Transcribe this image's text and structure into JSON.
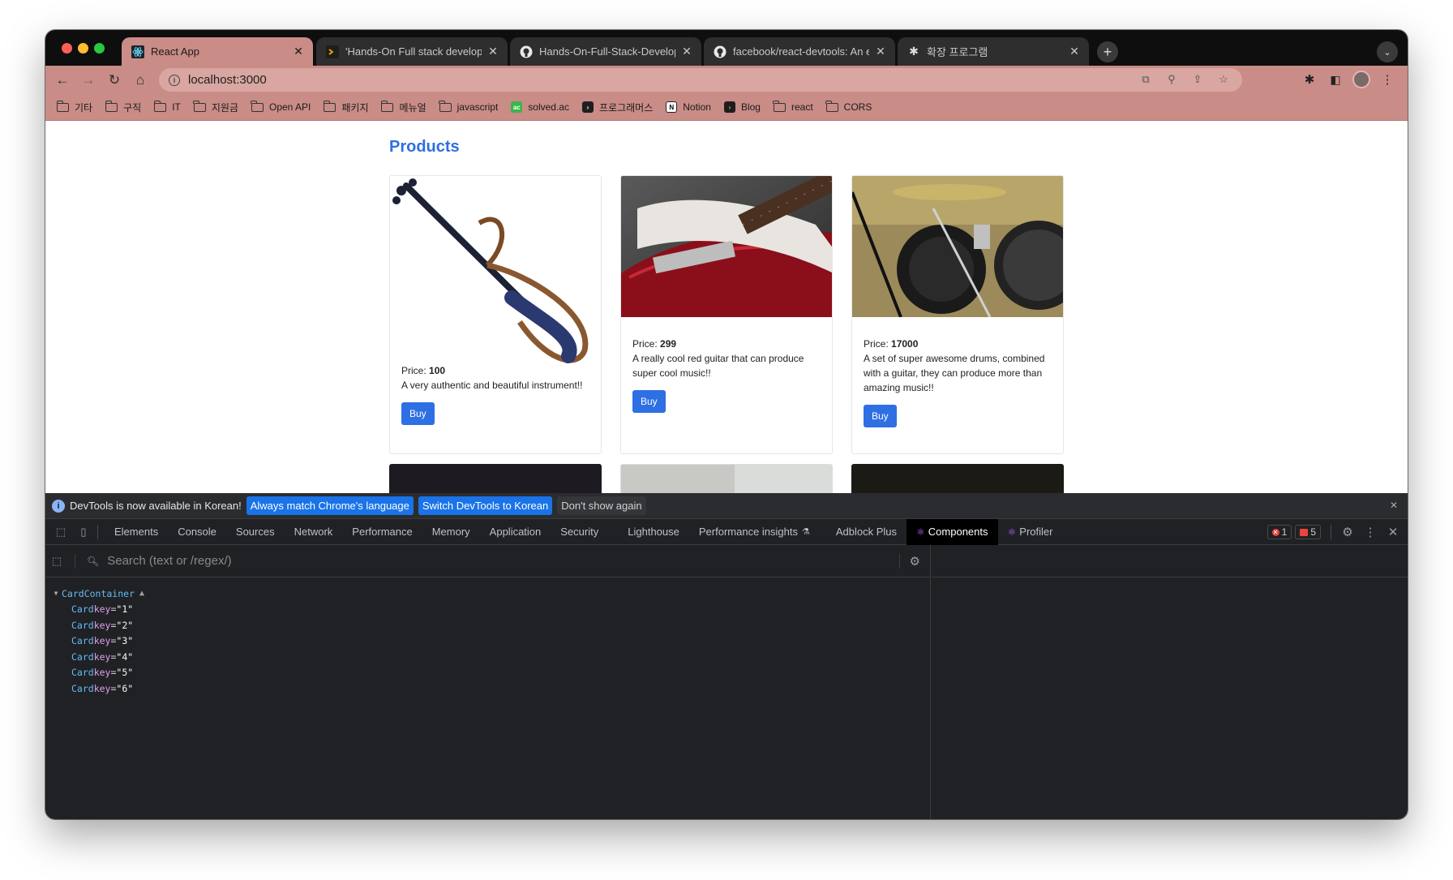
{
  "browser": {
    "tabs": [
      {
        "title": "React App",
        "icon": "react-icon",
        "active": true
      },
      {
        "title": "'Hands-On Full stack developm",
        "icon": "programmers-icon",
        "active": false
      },
      {
        "title": "Hands-On-Full-Stack-Develop",
        "icon": "github-icon",
        "active": false
      },
      {
        "title": "facebook/react-devtools: An e",
        "icon": "github-icon",
        "active": false
      },
      {
        "title": "확장 프로그램",
        "icon": "puzzle-icon",
        "active": false
      }
    ],
    "url": "localhost:3000",
    "accent_color": "#c98c87",
    "bookmarks": [
      {
        "label": "기타",
        "type": "folder"
      },
      {
        "label": "구직",
        "type": "folder"
      },
      {
        "label": "IT",
        "type": "folder"
      },
      {
        "label": "지원금",
        "type": "folder"
      },
      {
        "label": "Open API",
        "type": "folder"
      },
      {
        "label": "패키지",
        "type": "folder"
      },
      {
        "label": "메뉴얼",
        "type": "folder"
      },
      {
        "label": "javascript",
        "type": "folder"
      },
      {
        "label": "solved.ac",
        "type": "site"
      },
      {
        "label": "프로그래머스",
        "type": "site"
      },
      {
        "label": "Notion",
        "type": "site"
      },
      {
        "label": "Blog",
        "type": "site"
      },
      {
        "label": "react",
        "type": "folder"
      },
      {
        "label": "CORS",
        "type": "folder"
      }
    ]
  },
  "page": {
    "title": "Products",
    "accent_color": "#2f6fe4",
    "price_label": "Price:",
    "buy_label": "Buy",
    "products": [
      {
        "price": "100",
        "description": "A very authentic and beautiful instrument!!",
        "image": "violin"
      },
      {
        "price": "299",
        "description": "A really cool red guitar that can produce super cool music!!",
        "image": "guitar"
      },
      {
        "price": "17000",
        "description": "A set of super awesome drums, combined with a guitar, they can produce more than amazing music!!",
        "image": "drums"
      }
    ]
  },
  "devtools": {
    "infobar": {
      "message": "DevTools is now available in Korean!",
      "btn_match": "Always match Chrome's language",
      "btn_switch": "Switch DevTools to Korean",
      "btn_dismiss": "Don't show again"
    },
    "tabs": [
      "Elements",
      "Console",
      "Sources",
      "Network",
      "Performance",
      "Memory",
      "Application",
      "Security",
      "Lighthouse",
      "Performance insights",
      "Adblock Plus",
      "Components",
      "Profiler"
    ],
    "active_tab": "Components",
    "error_count": "1",
    "warning_count": "5",
    "search_placeholder": "Search (text or /regex/)",
    "tree": {
      "root": "CardContainer",
      "children": [
        {
          "name": "Card",
          "key": "1"
        },
        {
          "name": "Card",
          "key": "2"
        },
        {
          "name": "Card",
          "key": "3"
        },
        {
          "name": "Card",
          "key": "4"
        },
        {
          "name": "Card",
          "key": "5"
        },
        {
          "name": "Card",
          "key": "6"
        }
      ]
    }
  }
}
